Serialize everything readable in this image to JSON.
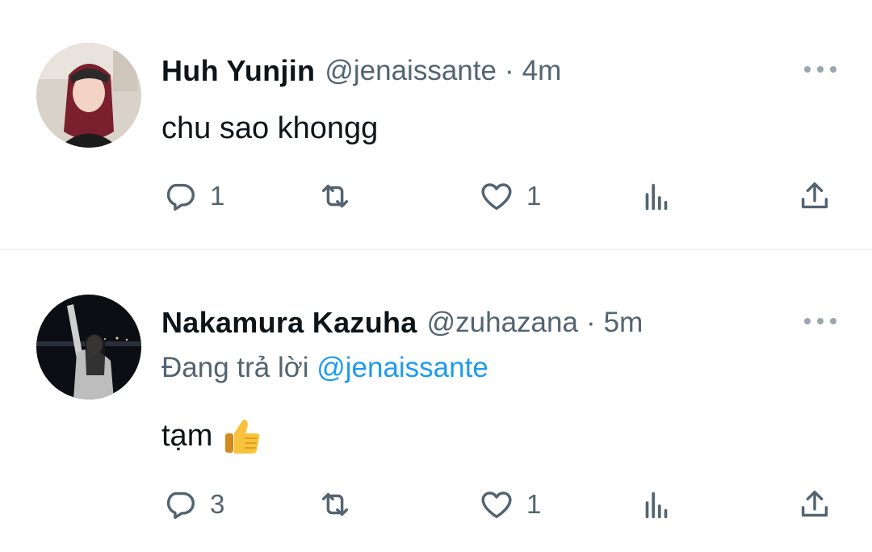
{
  "tweets": [
    {
      "display_name": "Huh Yunjin",
      "handle": "@jenaissante",
      "separator": "·",
      "time": "4m",
      "text": "chu sao khongg",
      "counts": {
        "reply": "1",
        "retweet": "",
        "like": "1"
      }
    },
    {
      "display_name": "Nakamura Kazuha",
      "handle": "@zuhazana",
      "separator": "·",
      "time": "5m",
      "replying_label": "Đang trả lời",
      "replying_to": "@jenaissante",
      "text": "tạm",
      "emoji": "thumbs-up",
      "counts": {
        "reply": "3",
        "retweet": "",
        "like": "1"
      }
    }
  ],
  "colors": {
    "text_primary": "#0f1419",
    "text_secondary": "#536471",
    "link": "#1d9bf0",
    "divider": "#eff3f4"
  },
  "icons": [
    "more-icon",
    "reply-icon",
    "retweet-icon",
    "like-icon",
    "views-icon",
    "share-icon"
  ]
}
